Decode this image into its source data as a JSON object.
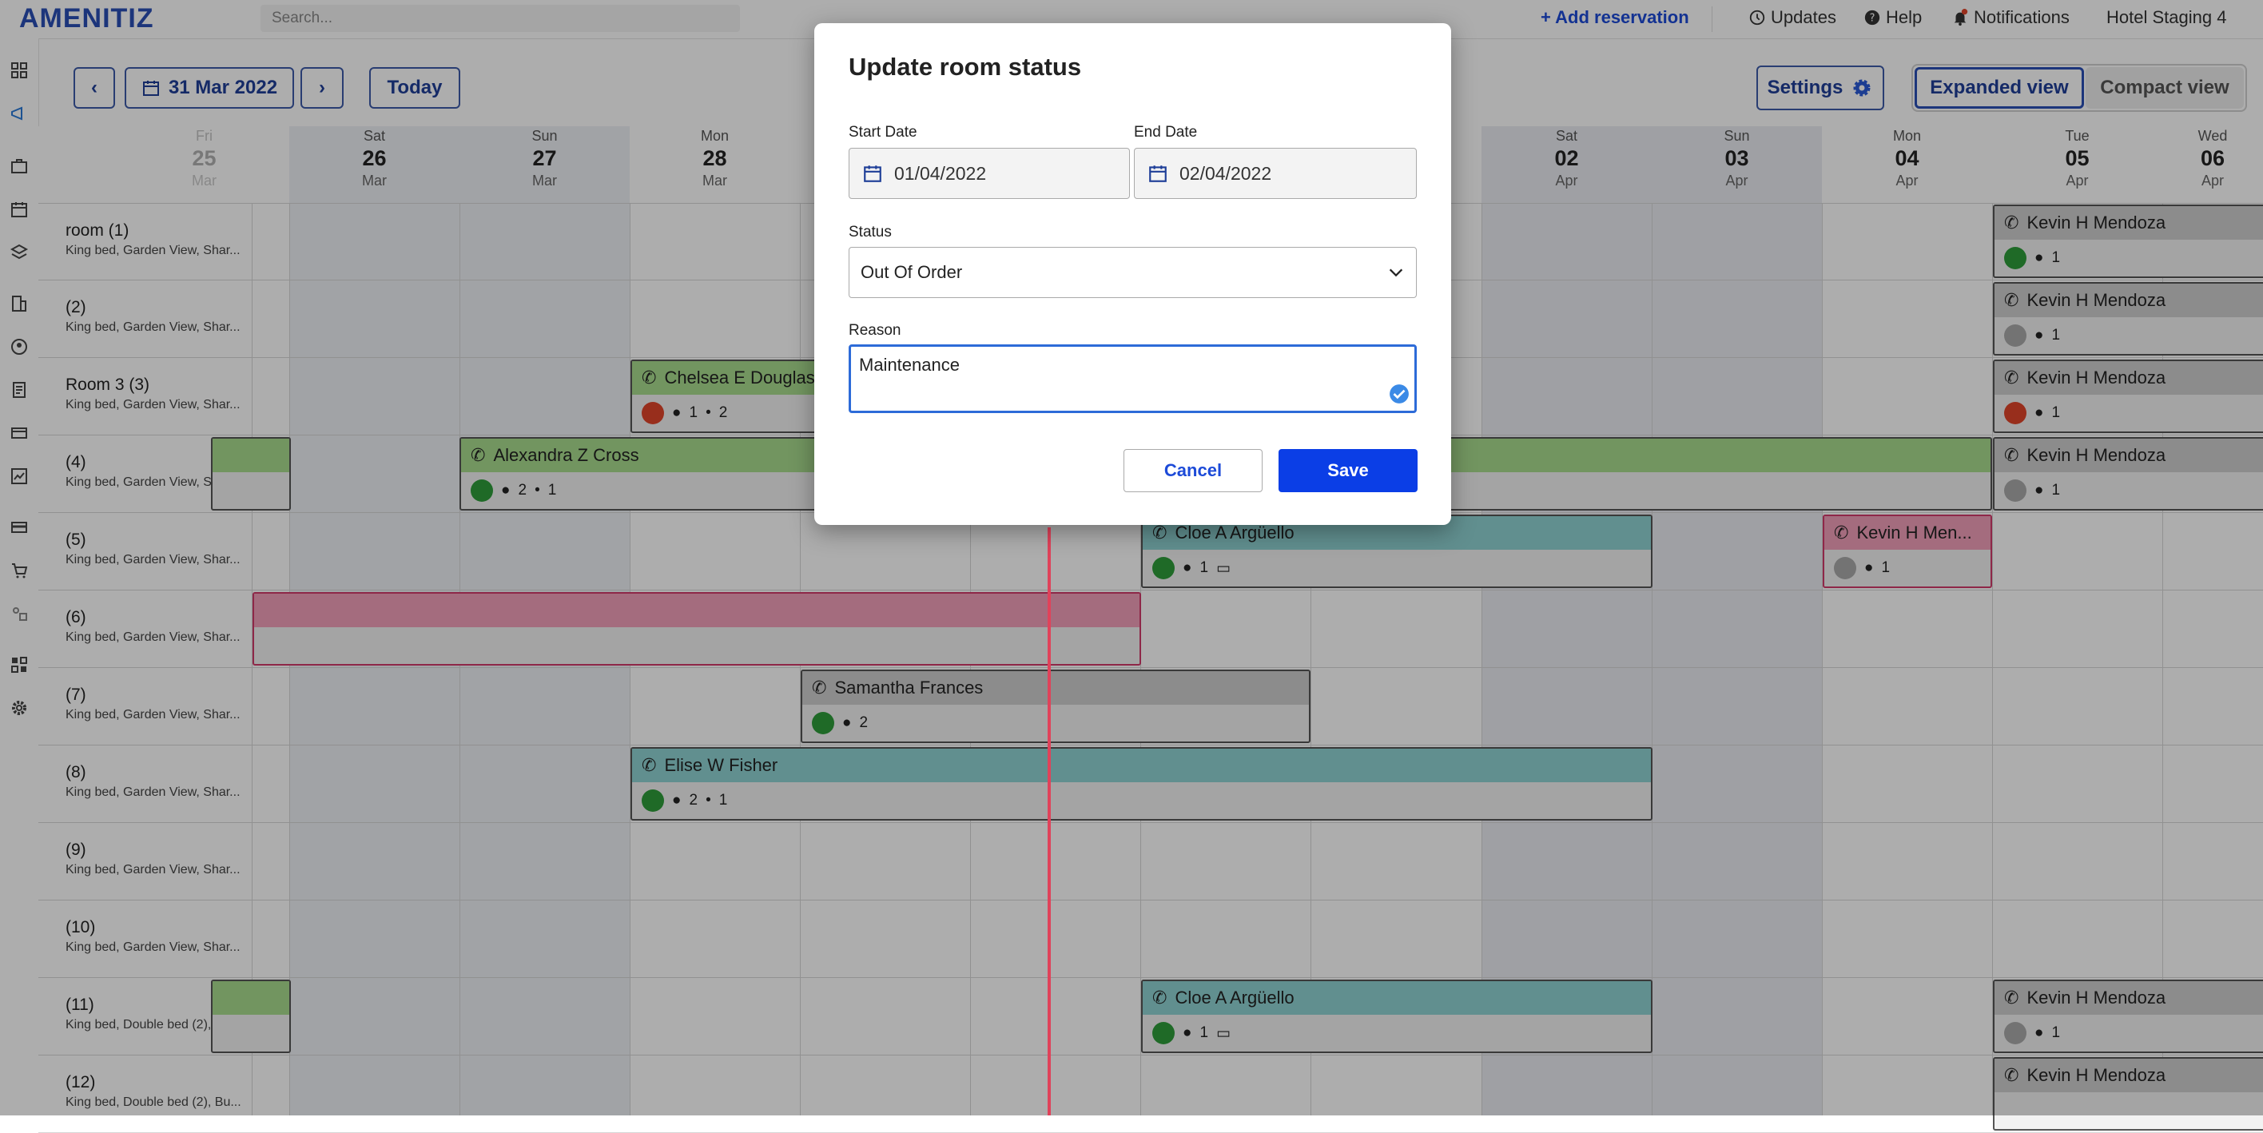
{
  "app": {
    "logo": "AMENITIZ",
    "search_placeholder": "Search..."
  },
  "topbar": {
    "add_reservation": "+ Add reservation",
    "updates": "Updates",
    "help": "Help",
    "notifications": "Notifications",
    "hotel": "Hotel Staging 4"
  },
  "toolbar": {
    "prev": "‹",
    "next": "›",
    "current_date": "31 Mar 2022",
    "today": "Today",
    "settings": "Settings",
    "expanded_view": "Expanded view",
    "compact_view": "Compact view"
  },
  "dates": [
    {
      "dow": "Fri",
      "num": "25",
      "mon": "Mar"
    },
    {
      "dow": "Sat",
      "num": "26",
      "mon": "Mar"
    },
    {
      "dow": "Sun",
      "num": "27",
      "mon": "Mar"
    },
    {
      "dow": "Mon",
      "num": "28",
      "mon": "Mar"
    },
    {
      "dow": "Sat",
      "num": "02",
      "mon": "Apr"
    },
    {
      "dow": "Sun",
      "num": "03",
      "mon": "Apr"
    },
    {
      "dow": "Mon",
      "num": "04",
      "mon": "Apr"
    },
    {
      "dow": "Tue",
      "num": "05",
      "mon": "Apr"
    },
    {
      "dow": "Wed",
      "num": "06",
      "mon": "Apr"
    }
  ],
  "rooms": [
    {
      "name": "room (1)",
      "desc": "King bed, Garden View, Shar..."
    },
    {
      "name": "(2)",
      "desc": "King bed, Garden View, Shar..."
    },
    {
      "name": "Room 3 (3)",
      "desc": "King bed, Garden View, Shar..."
    },
    {
      "name": "(4)",
      "desc": "King bed, Garden View, Shar..."
    },
    {
      "name": "(5)",
      "desc": "King bed, Garden View, Shar..."
    },
    {
      "name": "(6)",
      "desc": "King bed, Garden View, Shar..."
    },
    {
      "name": "(7)",
      "desc": "King bed, Garden View, Shar..."
    },
    {
      "name": "(8)",
      "desc": "King bed, Garden View, Shar..."
    },
    {
      "name": "(9)",
      "desc": "King bed, Garden View, Shar..."
    },
    {
      "name": "(10)",
      "desc": "King bed, Garden View, Shar..."
    },
    {
      "name": "(11)",
      "desc": "King bed, Double bed (2), Bu..."
    },
    {
      "name": "(12)",
      "desc": "King bed, Double bed (2), Bu..."
    }
  ],
  "reservations": [
    {
      "guest": "Kevin H Mendoza",
      "adults": "1",
      "children": "",
      "status": "green",
      "color": "grey"
    },
    {
      "guest": "Kevin H Mendoza",
      "adults": "1",
      "children": "",
      "status": "grey",
      "color": "grey"
    },
    {
      "guest": "Kevin H Mendoza",
      "adults": "1",
      "children": "",
      "status": "red",
      "color": "grey"
    },
    {
      "guest": "Kevin H Mendoza",
      "adults": "1",
      "children": "",
      "status": "grey",
      "color": "grey"
    },
    {
      "guest": "Chelsea E Douglas",
      "adults": "1",
      "children": "2",
      "status": "red",
      "color": "green"
    },
    {
      "guest": "Alexandra Z Cross",
      "adults": "2",
      "children": "1",
      "status": "green",
      "color": "green"
    },
    {
      "guest": "Cloe A Argüello",
      "adults": "1",
      "children": "",
      "status": "green",
      "color": "teal"
    },
    {
      "guest": "Kevin H Men...",
      "adults": "1",
      "children": "",
      "status": "grey",
      "color": "pink"
    },
    {
      "guest": "Samantha Frances",
      "adults": "2",
      "children": "",
      "status": "green",
      "color": "grey"
    },
    {
      "guest": "Elise W Fisher",
      "adults": "2",
      "children": "1",
      "status": "green",
      "color": "teal"
    },
    {
      "guest": "Cloe A Argüello",
      "adults": "1",
      "children": "",
      "status": "green",
      "color": "teal"
    },
    {
      "guest": "Kevin H Mendoza",
      "adults": "1",
      "children": "",
      "status": "grey",
      "color": "grey"
    },
    {
      "guest": "Kevin H Mendoza",
      "adults": "",
      "children": "",
      "status": "grey",
      "color": "grey"
    }
  ],
  "modal": {
    "title": "Update room status",
    "start_label": "Start Date",
    "start_value": "01/04/2022",
    "end_label": "End Date",
    "end_value": "02/04/2022",
    "status_label": "Status",
    "status_value": "Out Of Order",
    "reason_label": "Reason",
    "reason_value": "Maintenance",
    "cancel": "Cancel",
    "save": "Save"
  },
  "colors": {
    "accent": "#1d4bd8",
    "primary_button": "#0b3ee6",
    "green": "#a9dc8e",
    "teal": "#8fd3d3",
    "pink": "#f2a0ba",
    "today_line": "#e0425a"
  }
}
